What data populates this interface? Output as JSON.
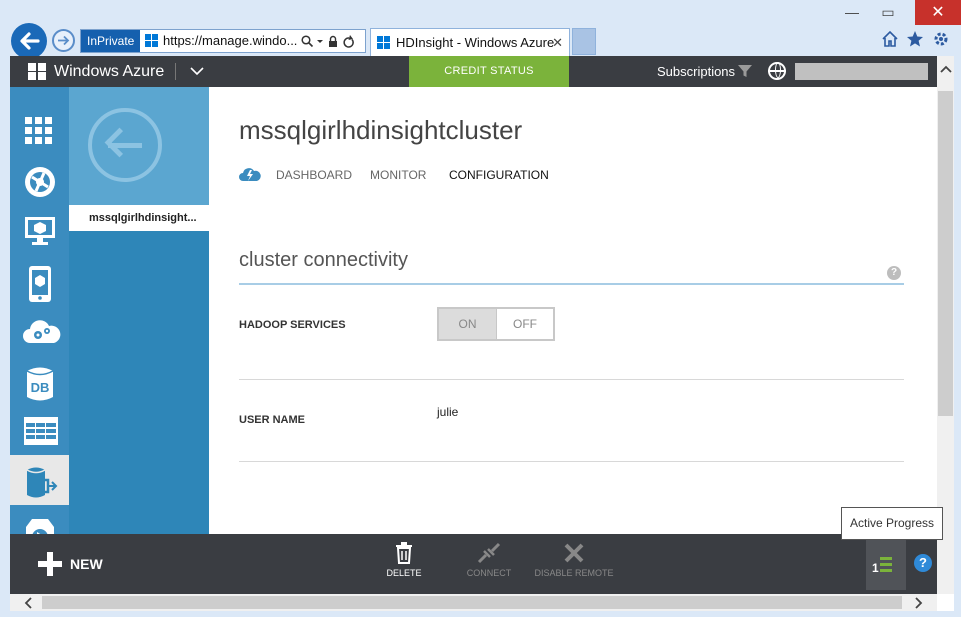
{
  "browser": {
    "inprivate_label": "InPrivate",
    "address_url": "https://manage.windo...",
    "tab_title": "HDInsight - Windows Azure",
    "close_glyph": "✕",
    "icons": [
      "home-icon",
      "favorites-star-icon",
      "settings-gear-icon"
    ]
  },
  "header": {
    "brand": "Windows Azure",
    "credit_status": "CREDIT STATUS",
    "subscriptions": "Subscriptions",
    "colors": {
      "bar": "#3a3d42",
      "credit": "#7bb33b"
    }
  },
  "sidebar": {
    "items": [
      {
        "icon": "all-items-grid-icon"
      },
      {
        "icon": "web-sites-icon"
      },
      {
        "icon": "virtual-machines-icon"
      },
      {
        "icon": "mobile-services-icon"
      },
      {
        "icon": "cloud-services-icon"
      },
      {
        "icon": "sql-databases-icon",
        "text": "DB"
      },
      {
        "icon": "storage-icon"
      },
      {
        "icon": "hdinsight-icon",
        "active": true
      },
      {
        "icon": "media-services-icon"
      }
    ]
  },
  "panel2": {
    "item_label": "mssqlgirlhdinsight..."
  },
  "main": {
    "title": "mssqlgirlhdinsightcluster",
    "tabs": [
      "DASHBOARD",
      "MONITOR",
      "CONFIGURATION"
    ],
    "active_tab": "CONFIGURATION",
    "section_title": "cluster connectivity",
    "help": "?",
    "hadoop_services_label": "HADOOP SERVICES",
    "toggle_on": "ON",
    "toggle_off": "OFF",
    "user_name_label": "USER NAME",
    "user_name_value": "julie"
  },
  "cmdbar": {
    "new_label": "NEW",
    "delete_label": "DELETE",
    "connect_label": "CONNECT",
    "disable_remote_label": "DISABLE REMOTE",
    "progress_count": "1",
    "help": "?"
  },
  "tooltip": {
    "text": "Active Progress"
  }
}
